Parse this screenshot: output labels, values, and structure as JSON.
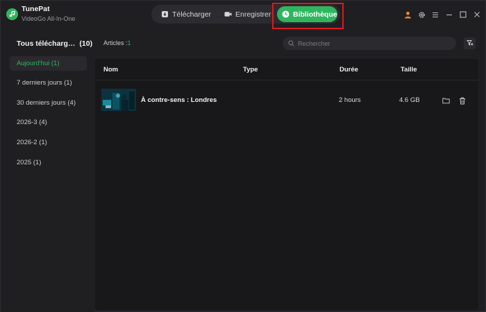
{
  "app": {
    "name": "TunePat",
    "subtitle": "VideoGo All-In-One"
  },
  "nav": {
    "tabs": [
      {
        "label": "Télécharger",
        "icon": "download-icon"
      },
      {
        "label": "Enregistrer",
        "icon": "record-icon"
      },
      {
        "label": "Bibliothèque",
        "icon": "clock-icon",
        "active": true
      }
    ]
  },
  "window_controls": [
    "account-icon",
    "settings-icon",
    "menu-icon",
    "minimize-icon",
    "maximize-icon",
    "close-icon"
  ],
  "sidebar": {
    "header_label": "Tous télécharg…",
    "header_count": "(10)",
    "items": [
      {
        "label": "Aujourd'hui (1)",
        "active": true
      },
      {
        "label": "7 derniers jours (1)"
      },
      {
        "label": "30 derniers jours (4)"
      },
      {
        "label": "2026-3 (4)"
      },
      {
        "label": "2026-2 (1)"
      },
      {
        "label": "2025 (1)"
      }
    ]
  },
  "toolbar": {
    "articles_label": "Articles :",
    "articles_count": "1",
    "search_placeholder": "Rechercher"
  },
  "table": {
    "headers": {
      "name": "Nom",
      "type": "Type",
      "duration": "Durée",
      "size": "Taille"
    },
    "rows": [
      {
        "title": "À contre-sens : Londres",
        "type": "",
        "duration": "2 hours",
        "size": "4.6 GB"
      }
    ]
  },
  "colors": {
    "accent": "#2fb55f",
    "highlight": "#e0181d",
    "background": "#1f1f22",
    "panel": "#18181b"
  }
}
